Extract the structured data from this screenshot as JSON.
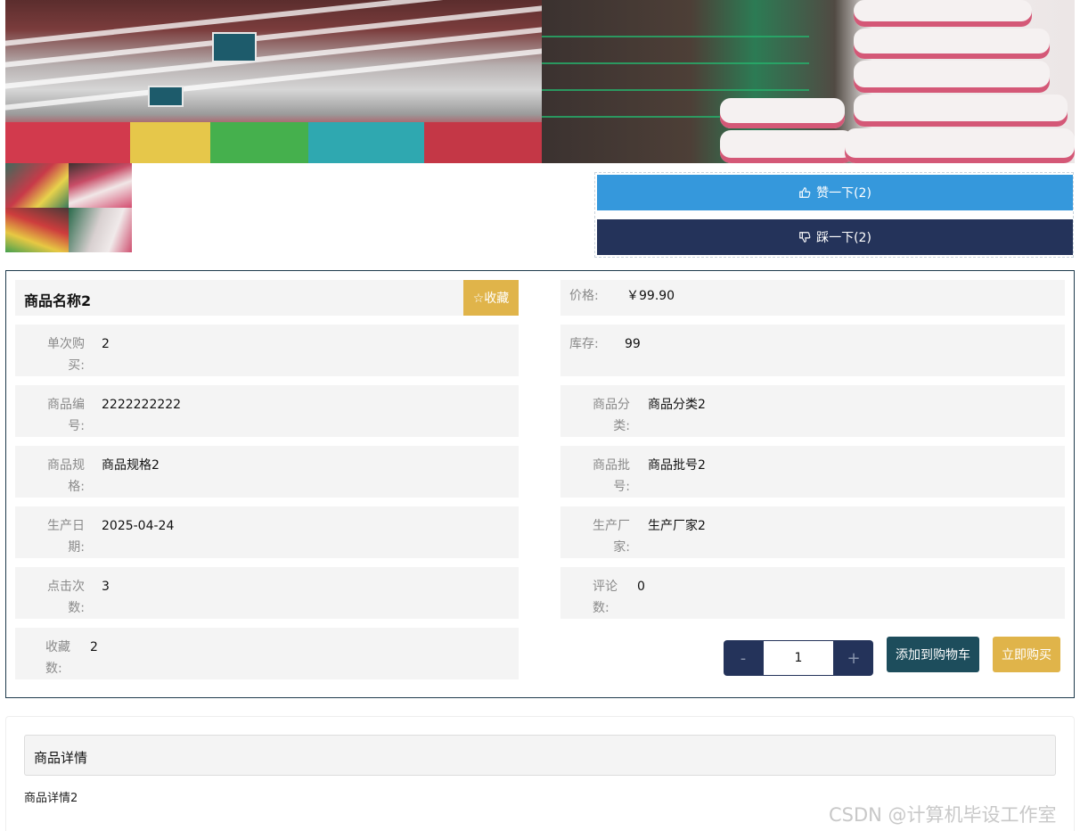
{
  "vote": {
    "up_label": "赞一下(2)",
    "down_label": "踩一下(2)",
    "up_icon": "thumbs-up-icon",
    "down_icon": "thumbs-down-icon"
  },
  "product": {
    "name": "商品名称2",
    "favorite_label": "☆收藏",
    "price_label": "价格:",
    "price": "￥99.90",
    "fields": [
      {
        "label": "单次购买:",
        "value": "2"
      },
      {
        "label": "库存:",
        "value": "99"
      },
      {
        "label": "商品编号:",
        "value": "2222222222"
      },
      {
        "label": "商品分类:",
        "value": "商品分类2"
      },
      {
        "label": "商品规格:",
        "value": "商品规格2"
      },
      {
        "label": "商品批号:",
        "value": "商品批号2"
      },
      {
        "label": "生产日期:",
        "value": "2025-04-24"
      },
      {
        "label": "生产厂家:",
        "value": "生产厂家2"
      },
      {
        "label": "点击次数:",
        "value": "3"
      },
      {
        "label": "评论数:",
        "value": "0"
      },
      {
        "label": "收藏数:",
        "value": "2"
      }
    ]
  },
  "purchase": {
    "minus": "-",
    "quantity": "1",
    "plus": "+",
    "cart_label": "添加到购物车",
    "buy_label": "立即购买"
  },
  "detail": {
    "heading": "商品详情",
    "content": "商品详情2"
  },
  "watermark": "CSDN @计算机毕设工作室",
  "colors": {
    "like_blue": "#3598dc",
    "navy": "#24335a",
    "teal": "#1d4d5c",
    "gold": "#e0b44a",
    "panel_border": "#1f3b4d"
  }
}
